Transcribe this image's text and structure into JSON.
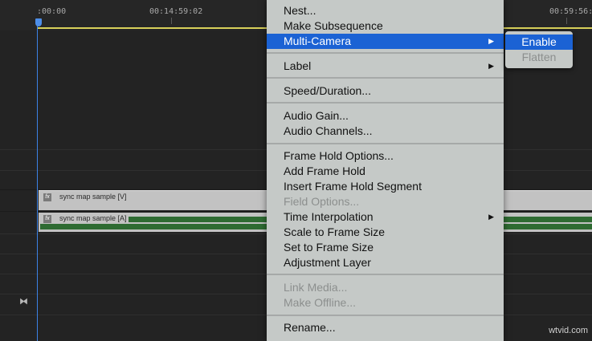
{
  "ruler": {
    "tc_start": ":00:00",
    "tc_mid": "00:14:59:02",
    "tc_end": "00:59:56:0"
  },
  "clips": {
    "video_name": "sync map sample [V]",
    "audio_name": "sync map sample [A]",
    "fx_label": "fx"
  },
  "menu": {
    "nest": "Nest...",
    "make_subsequence": "Make Subsequence",
    "multi_camera": "Multi-Camera",
    "label": "Label",
    "speed_duration": "Speed/Duration...",
    "audio_gain": "Audio Gain...",
    "audio_channels": "Audio Channels...",
    "frame_hold_options": "Frame Hold Options...",
    "add_frame_hold": "Add Frame Hold",
    "insert_frame_hold_segment": "Insert Frame Hold Segment",
    "field_options": "Field Options...",
    "time_interpolation": "Time Interpolation",
    "scale_to_frame_size": "Scale to Frame Size",
    "set_to_frame_size": "Set to Frame Size",
    "adjustment_layer": "Adjustment Layer",
    "link_media": "Link Media...",
    "make_offline": "Make Offline...",
    "rename": "Rename...",
    "submenu_arrow": "▶"
  },
  "submenu": {
    "enable": "Enable",
    "flatten": "Flatten"
  },
  "watermark": "wtvid.com",
  "colors": {
    "selection": "#1b62d4",
    "menu_bg": "#c5c9c7",
    "playhead": "#3c82e6",
    "audio_wave": "#2e6b32"
  }
}
